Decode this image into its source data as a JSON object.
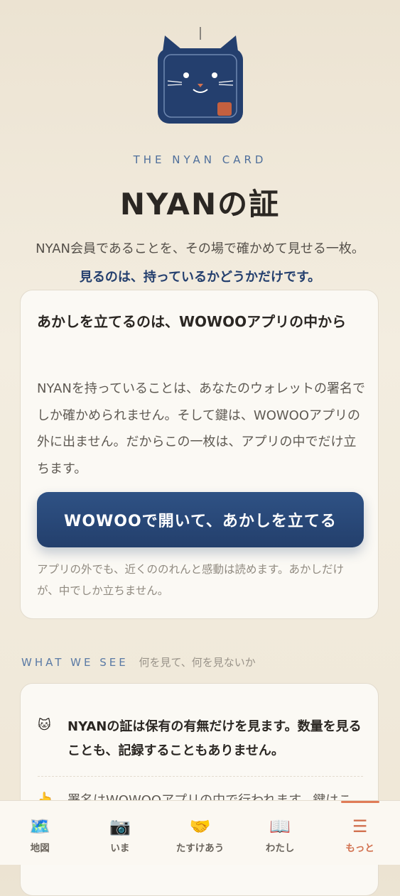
{
  "hero": {
    "eyebrow": "THE NYAN CARD",
    "title": "NYANの証",
    "lead": "NYAN会員であることを、その場で確かめて見せる一枚。",
    "lead_strong": "見るのは、持っているかどうかだけです。"
  },
  "card": {
    "heading": "あかしを立てるのは、WOWOOアプリの中から",
    "body": "NYANを持っていることは、あなたのウォレットの署名でしか確かめられません。そして鍵は、WOWOOアプリの外に出ません。だからこの一枚は、アプリの中でだけ立ちます。",
    "cta_label": "WOWOOで開いて、あかしを立てる",
    "note": "アプリの外でも、近くののれんと感動は読めます。あかしだけが、中でしか立ちません。"
  },
  "section": {
    "label_en": "WHAT WE SEE",
    "label_ja": "何を見て、何を見ないか"
  },
  "see_items": [
    {
      "icon": "cat-face-icon",
      "glyph": "🐱",
      "text": "NYANの証は保有の有無だけを見ます。数量を見ることも、記録することもありません。"
    },
    {
      "icon": "hand-icon",
      "glyph": "👆",
      "text": "署名はWOWOOアプリの中で行われます。鍵はこ"
    }
  ],
  "tabbar": {
    "tabs": [
      {
        "label": "地図",
        "icon": "world-map-icon",
        "glyph": "🗺️"
      },
      {
        "label": "いま",
        "icon": "camera-icon",
        "glyph": "📷"
      },
      {
        "label": "たすけあう",
        "icon": "handshake-icon",
        "glyph": "🤝"
      },
      {
        "label": "わたし",
        "icon": "book-icon",
        "glyph": "📖"
      },
      {
        "label": "もっと",
        "icon": "menu-icon",
        "glyph": "☰"
      }
    ],
    "active_color": "#d2714f"
  },
  "colors": {
    "navy": "#243f6e",
    "accent": "#d2714f",
    "background": "#f3ede0"
  }
}
